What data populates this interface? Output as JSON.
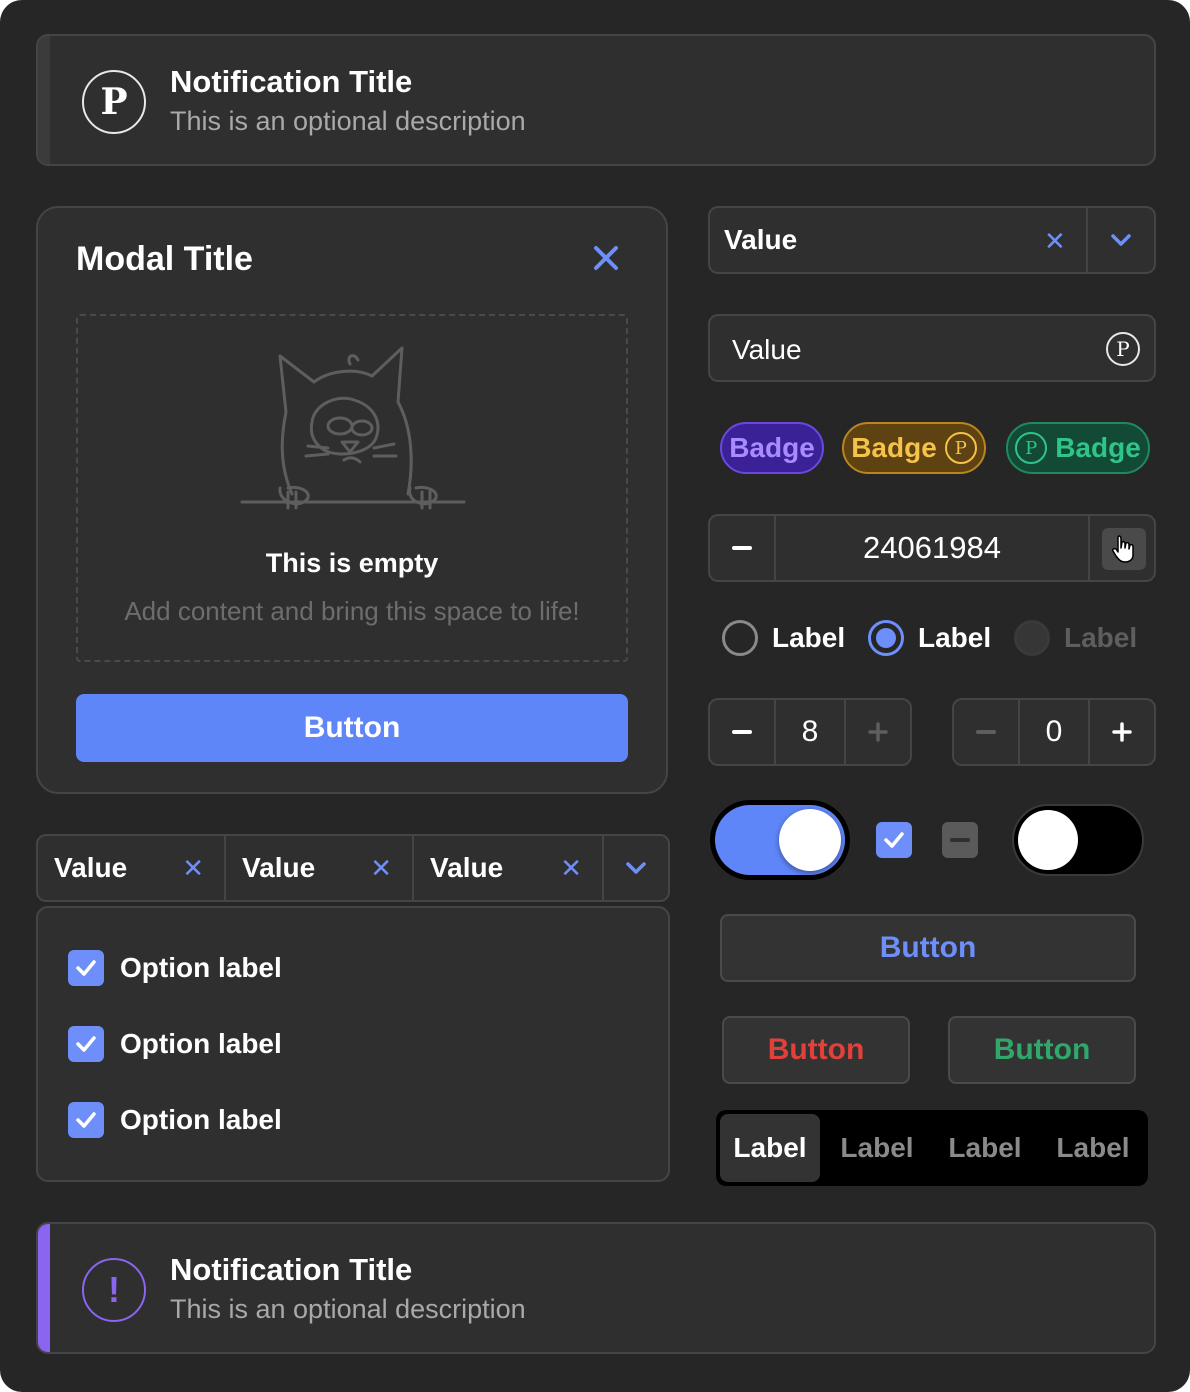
{
  "notifications": [
    {
      "title": "Notification Title",
      "description": "This is an optional description",
      "icon": "p-coin-icon",
      "accent": "#3b3b3b"
    },
    {
      "title": "Notification Title",
      "description": "This is an optional description",
      "icon": "exclamation-icon",
      "accent": "#8b64f0"
    }
  ],
  "modal": {
    "title": "Modal Title",
    "empty_title": "This is empty",
    "empty_description": "Add content and bring this space to life!",
    "button_label": "Button"
  },
  "multi_select": {
    "chips": [
      "Value",
      "Value",
      "Value"
    ],
    "options": [
      "Option label",
      "Option label",
      "Option label"
    ]
  },
  "select": {
    "value": "Value"
  },
  "input": {
    "value": "Value"
  },
  "badges": [
    {
      "label": "Badge",
      "color": "#a98bff",
      "bg": "#3a2296",
      "border": "#6a48e0"
    },
    {
      "label": "Badge",
      "color": "#f5c24a",
      "bg": "#5e4211",
      "border": "#b8861f"
    },
    {
      "label": "Badge",
      "color": "#2fc48a",
      "bg": "#124a35",
      "border": "#1f8a5e"
    }
  ],
  "number_input": {
    "value": "24061984"
  },
  "radios": [
    {
      "label": "Label",
      "state": "unchecked"
    },
    {
      "label": "Label",
      "state": "checked"
    },
    {
      "label": "Label",
      "state": "disabled"
    }
  ],
  "steppers": [
    {
      "value": "8",
      "minus": "−",
      "plus": "+"
    },
    {
      "value": "0",
      "minus": "−",
      "plus": "+"
    }
  ],
  "buttons": {
    "primary": "Button",
    "danger": "Button",
    "success": "Button"
  },
  "segmented": {
    "items": [
      "Label",
      "Label",
      "Label",
      "Label"
    ],
    "selected_index": 0
  },
  "colors": {
    "accent_blue": "#5f86f8",
    "danger": "#e0413a",
    "success": "#2fa86a"
  }
}
